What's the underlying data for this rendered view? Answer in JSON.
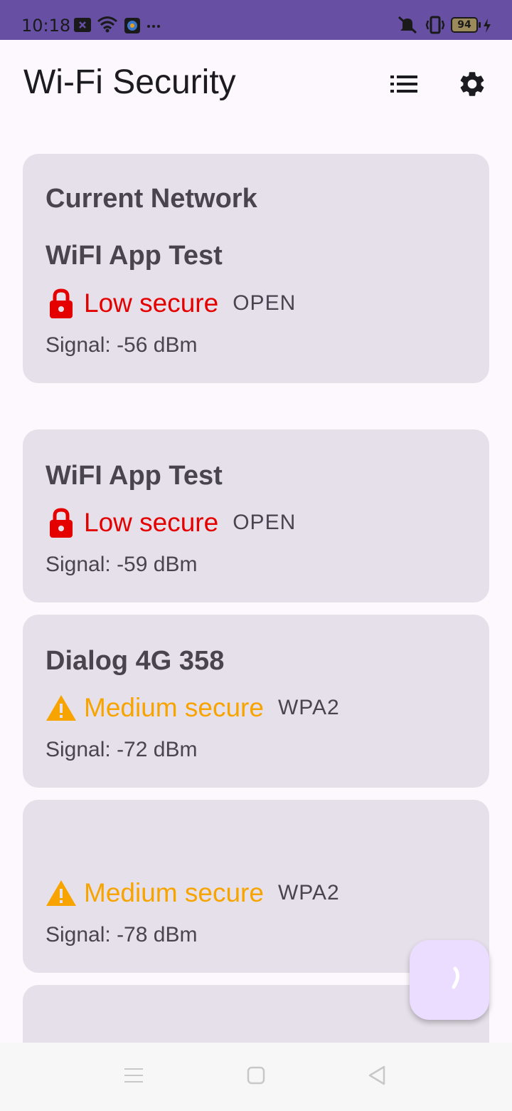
{
  "status_bar": {
    "time": "10:18",
    "battery": "94",
    "icons": [
      "notification-x-icon",
      "wifi-icon",
      "app-notification-icon",
      "more-dots-icon",
      "mute-vibrate-icon",
      "vibrate-icon",
      "battery-icon",
      "charging-icon"
    ],
    "color": "#6750a4"
  },
  "app_bar": {
    "title": "Wi-Fi Security",
    "actions": [
      "list-icon",
      "settings-icon"
    ]
  },
  "current_network": {
    "heading": "Current Network",
    "name": "WiFI App Test",
    "security_label": "Low secure",
    "security_type": "OPEN",
    "signal": "Signal: -56 dBm",
    "icon": "lock-icon"
  },
  "networks": [
    {
      "name": "WiFI App Test",
      "security_label": "Low secure",
      "security_type": "OPEN",
      "signal": "Signal: -59 dBm",
      "level": "low",
      "icon": "lock-icon"
    },
    {
      "name": "Dialog 4G 358",
      "security_label": "Medium secure",
      "security_type": "WPA2",
      "signal": "Signal: -72 dBm",
      "level": "medium",
      "icon": "warning-icon"
    },
    {
      "name": "",
      "security_label": "Medium secure",
      "security_type": "WPA2",
      "signal": "Signal: -78 dBm",
      "level": "medium",
      "icon": "warning-icon"
    }
  ],
  "colors": {
    "low": "#e50000",
    "medium": "#f7a400",
    "card": "#e6e0ea",
    "fab": "#eaddff"
  },
  "fab": {
    "icon": "loading-spinner-icon"
  },
  "nav_bar": {
    "buttons": [
      "menu-icon",
      "home-square-icon",
      "back-triangle-icon"
    ]
  }
}
